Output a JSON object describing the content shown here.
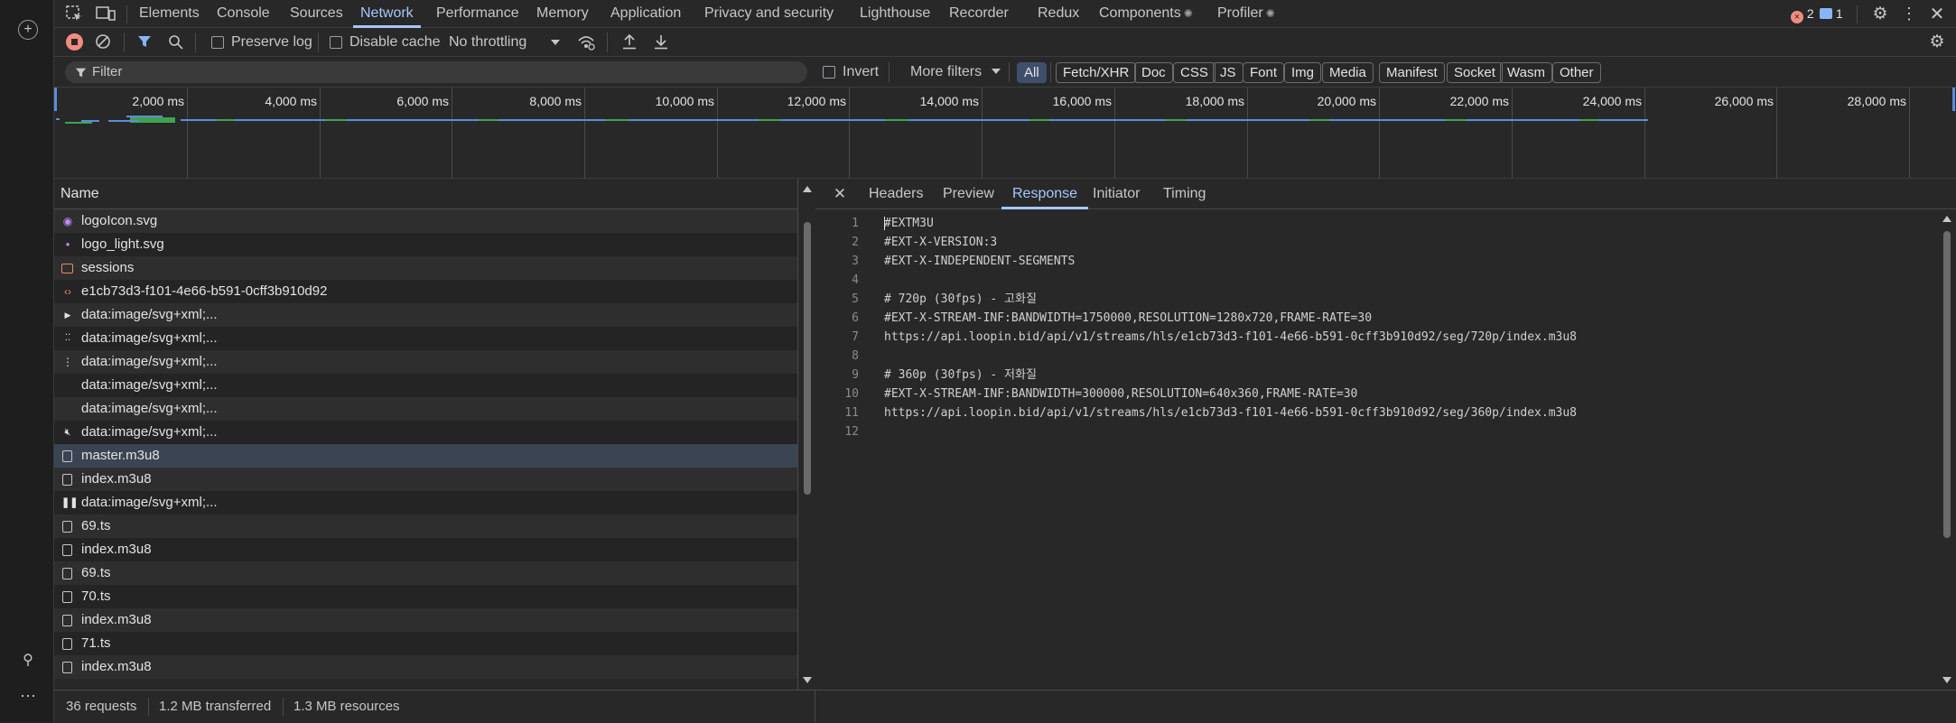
{
  "tabs": [
    {
      "label": "Elements"
    },
    {
      "label": "Console"
    },
    {
      "label": "Sources"
    },
    {
      "label": "Network",
      "active": true
    },
    {
      "label": "Performance"
    },
    {
      "label": "Memory"
    },
    {
      "label": "Application"
    },
    {
      "label": "Privacy and security"
    },
    {
      "label": "Lighthouse"
    },
    {
      "label": "Recorder"
    },
    {
      "label": "Redux"
    },
    {
      "label": "Components"
    },
    {
      "label": "Profiler"
    }
  ],
  "badges": {
    "errors": "2",
    "messages": "1"
  },
  "toolbar": {
    "preserve_log": "Preserve log",
    "disable_cache": "Disable cache",
    "throttling": "No throttling"
  },
  "filterbar": {
    "placeholder": "Filter",
    "invert": "Invert",
    "more_filters": "More filters",
    "types": [
      "All",
      "Fetch/XHR",
      "Doc",
      "CSS",
      "JS",
      "Font",
      "Img",
      "Media",
      "Manifest",
      "Socket",
      "Wasm",
      "Other"
    ]
  },
  "timeline": {
    "ticks": [
      "2,000 ms",
      "4,000 ms",
      "6,000 ms",
      "8,000 ms",
      "10,000 ms",
      "12,000 ms",
      "14,000 ms",
      "16,000 ms",
      "18,000 ms",
      "20,000 ms",
      "22,000 ms",
      "24,000 ms",
      "26,000 ms",
      "28,000 ms"
    ]
  },
  "list": {
    "header": "Name",
    "rows": [
      {
        "name": "logoIcon.svg",
        "icon": "svg-icon"
      },
      {
        "name": "logo_light.svg",
        "icon": "svg-icon"
      },
      {
        "name": "sessions",
        "icon": "fetch-icon"
      },
      {
        "name": "e1cb73d3-f101-4e66-b591-0cff3b910d92",
        "icon": "xhr-icon"
      },
      {
        "name": "data:image/svg+xml;...",
        "icon": "play-icon"
      },
      {
        "name": "data:image/svg+xml;...",
        "icon": "grid-icon"
      },
      {
        "name": "data:image/svg+xml;...",
        "icon": "dots-icon"
      },
      {
        "name": "data:image/svg+xml;...",
        "icon": "blank-icon"
      },
      {
        "name": "data:image/svg+xml;...",
        "icon": "blank-icon"
      },
      {
        "name": "data:image/svg+xml;...",
        "icon": "mute-icon"
      },
      {
        "name": "master.m3u8",
        "icon": "document-icon",
        "selected": true
      },
      {
        "name": "index.m3u8",
        "icon": "document-icon"
      },
      {
        "name": "data:image/svg+xml;...",
        "icon": "pause-icon"
      },
      {
        "name": "69.ts",
        "icon": "document-icon"
      },
      {
        "name": "index.m3u8",
        "icon": "document-icon"
      },
      {
        "name": "69.ts",
        "icon": "document-icon"
      },
      {
        "name": "70.ts",
        "icon": "document-icon"
      },
      {
        "name": "index.m3u8",
        "icon": "document-icon"
      },
      {
        "name": "71.ts",
        "icon": "document-icon"
      },
      {
        "name": "index.m3u8",
        "icon": "document-icon"
      }
    ]
  },
  "detail": {
    "tabs": [
      {
        "label": "Headers"
      },
      {
        "label": "Preview"
      },
      {
        "label": "Response",
        "active": true
      },
      {
        "label": "Initiator"
      },
      {
        "label": "Timing"
      }
    ],
    "lines": [
      {
        "n": "1",
        "text": "#EXTM3U"
      },
      {
        "n": "2",
        "text": "#EXT-X-VERSION:3"
      },
      {
        "n": "3",
        "text": "#EXT-X-INDEPENDENT-SEGMENTS"
      },
      {
        "n": "4",
        "text": ""
      },
      {
        "n": "5",
        "text": "# 720p (30fps) - 고화질"
      },
      {
        "n": "6",
        "text": "#EXT-X-STREAM-INF:BANDWIDTH=1750000,RESOLUTION=1280x720,FRAME-RATE=30"
      },
      {
        "n": "7",
        "text": "https://api.loopin.bid/api/v1/streams/hls/e1cb73d3-f101-4e66-b591-0cff3b910d92/seg/720p/index.m3u8"
      },
      {
        "n": "8",
        "text": ""
      },
      {
        "n": "9",
        "text": "# 360p (30fps) - 저화질"
      },
      {
        "n": "10",
        "text": "#EXT-X-STREAM-INF:BANDWIDTH=300000,RESOLUTION=640x360,FRAME-RATE=30"
      },
      {
        "n": "11",
        "text": "https://api.loopin.bid/api/v1/streams/hls/e1cb73d3-f101-4e66-b591-0cff3b910d92/seg/360p/index.m3u8"
      },
      {
        "n": "12",
        "text": ""
      }
    ]
  },
  "status": {
    "requests": "36 requests",
    "transferred": "1.2 MB transferred",
    "resources": "1.3 MB resources"
  },
  "colors": {
    "accent": "#a8c7fa",
    "record_red": "#f28b82",
    "error_red": "#f28b82",
    "timeline_blue": "#5b8dd9",
    "timeline_green": "#3fa34d"
  }
}
